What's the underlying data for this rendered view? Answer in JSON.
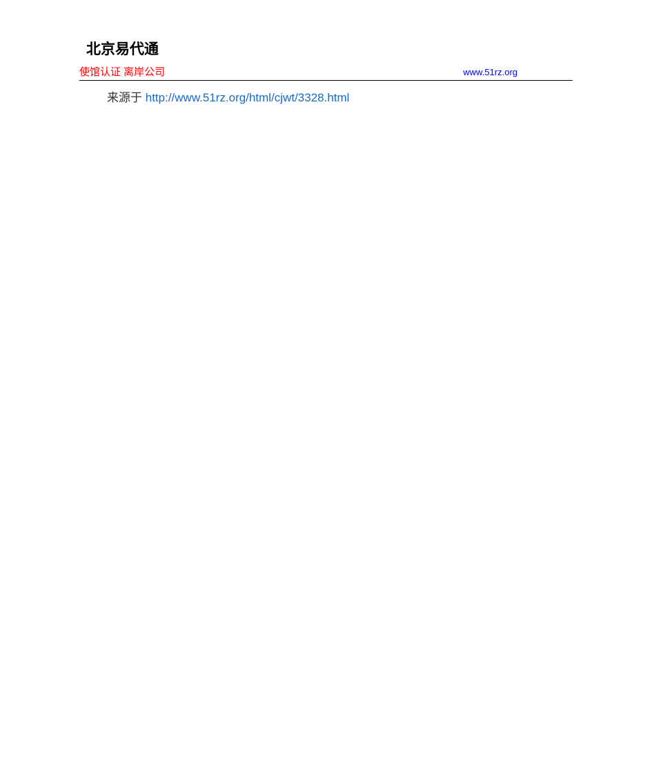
{
  "header": {
    "title": "北京易代通",
    "subtitle_left": "使馆认证  离岸公司",
    "subtitle_right": "www.51rz.org"
  },
  "content": {
    "source_prefix": "来源于 ",
    "source_url": "http://www.51rz.org/html/cjwt/3328.html"
  }
}
